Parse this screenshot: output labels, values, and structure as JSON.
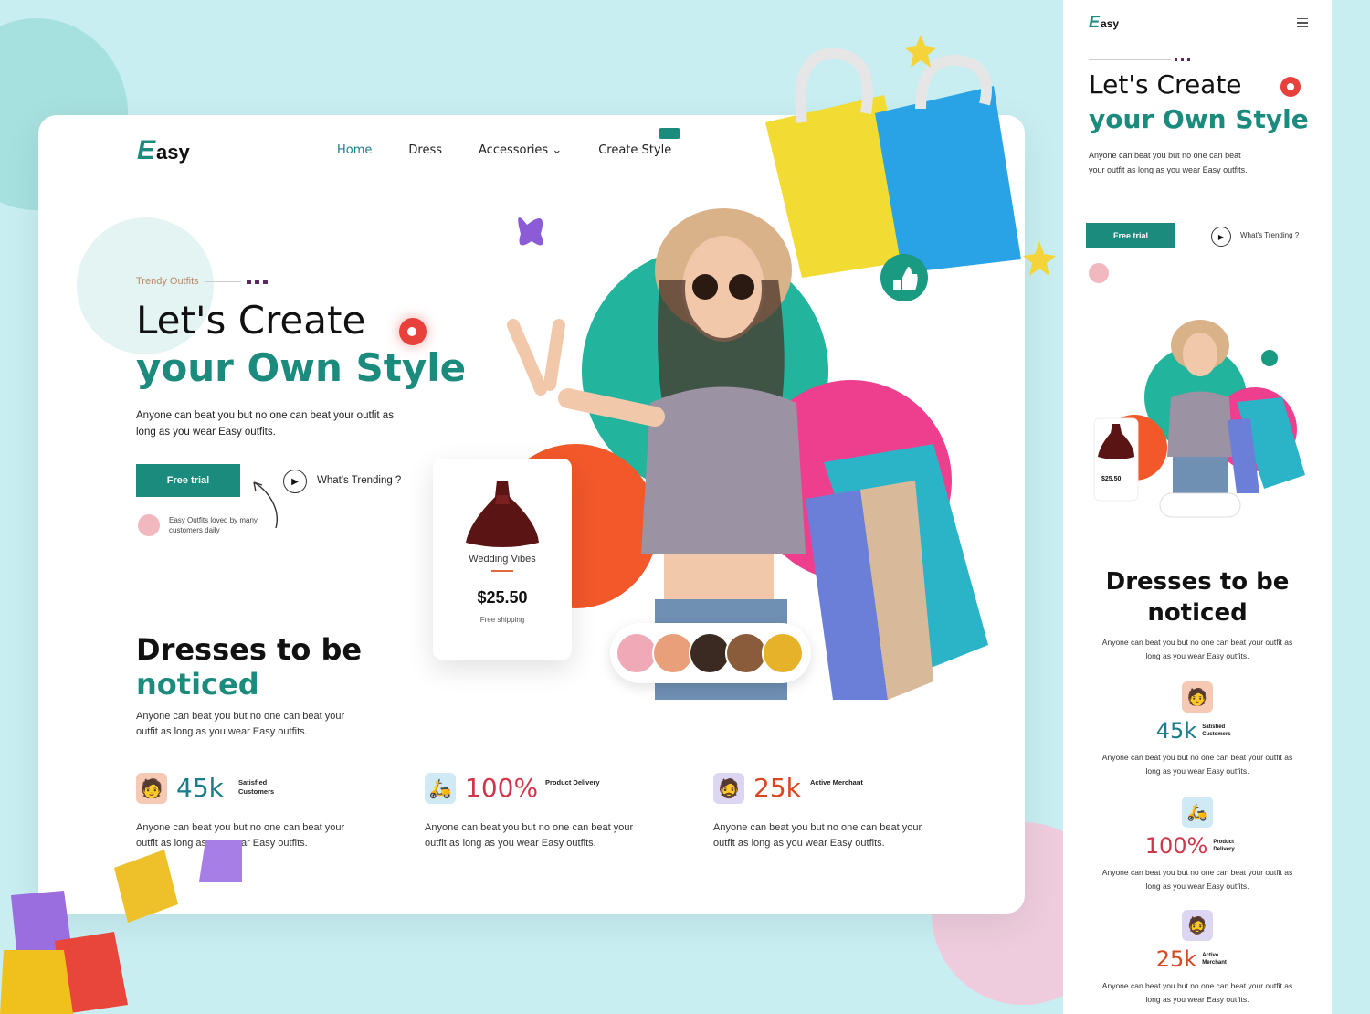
{
  "brand": {
    "initial": "E",
    "rest": "asy"
  },
  "nav": {
    "items": [
      {
        "label": "Home",
        "active": true
      },
      {
        "label": "Dress",
        "active": false
      },
      {
        "label": "Accessories",
        "active": false,
        "chevron": true
      },
      {
        "label": "Create Style",
        "active": false
      }
    ]
  },
  "hero": {
    "eyebrow": "Trendy Outfits",
    "title_line1": "Let's Create",
    "title_line2": "your Own Style",
    "lead": "Anyone can beat you but no one can beat your outfit as long as you wear Easy outfits.",
    "cta_label": "Free trial",
    "trending_label": "What's Trending ?",
    "mini_user_text": "Easy Outfits loved by many customers daily"
  },
  "product_card": {
    "name": "Wedding Vibes",
    "price": "$25.50",
    "sub": "Free shipping"
  },
  "section": {
    "title_line1": "Dresses to be",
    "title_line2": "noticed",
    "desc": "Anyone can beat you but no one can beat your outfit as long as you wear Easy outfits."
  },
  "stats": [
    {
      "value": "45k",
      "label": "Satisfied Customers",
      "color": "#1a7d8b",
      "icon": "customer-icon",
      "icon_bg": "#f6c9b4",
      "text": "Anyone can beat you but no one can beat your outfit as long as you wear Easy outfits."
    },
    {
      "value": "100%",
      "label": "Product Delivery",
      "color": "#d0364b",
      "icon": "delivery-icon",
      "icon_bg": "#cfeaf5",
      "text": "Anyone can beat you but no one can beat your outfit as long as you wear Easy outfits."
    },
    {
      "value": "25k",
      "label": "Active Merchant",
      "color": "#d8471f",
      "icon": "merchant-icon",
      "icon_bg": "#dcd6f2",
      "text": "Anyone can beat you but no one can beat your outfit as long as you wear Easy outfits."
    }
  ],
  "mobile": {
    "cta_label": "Free trial",
    "trending_label": "What's Trending ?",
    "price": "$25.50"
  },
  "colors": {
    "accent": "#1a8b7c",
    "background": "#c8eef2"
  }
}
